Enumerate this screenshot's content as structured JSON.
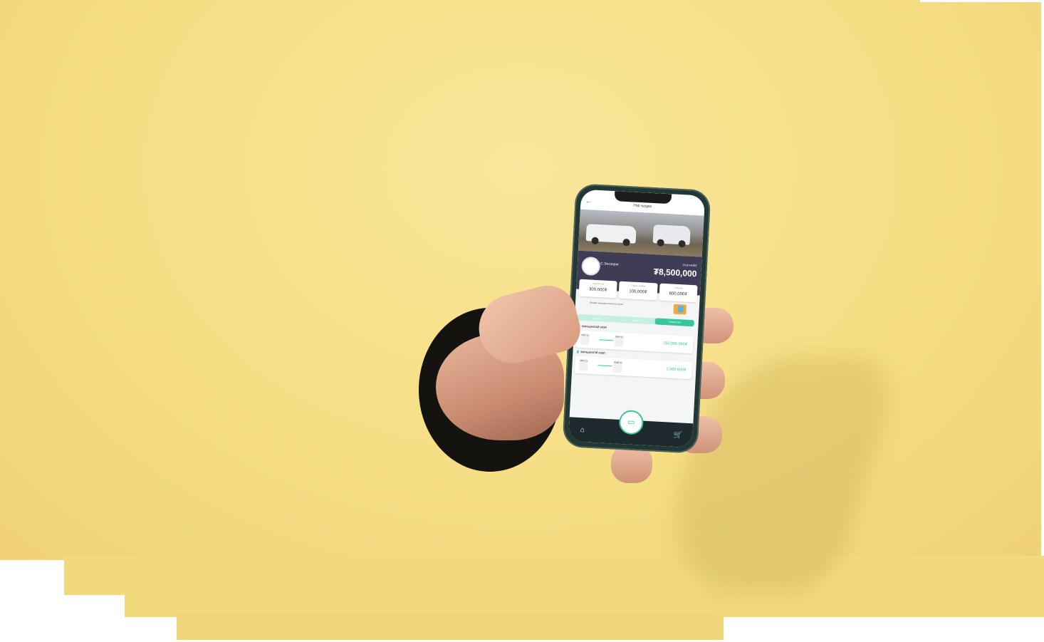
{
  "app": {
    "title": "Нэр хуудас",
    "user_name": "С.Энхзориг",
    "price_label": "ҮНЭ НИЙТ",
    "price_value": "₮8,500,000"
  },
  "cards": [
    {
      "label": "Урьдчилгаа",
      "value": "300,000₮"
    },
    {
      "label": "Сарын төлбөр",
      "value": "100,000₮"
    },
    {
      "label": "Үлдэгдэл",
      "value": "600,000₮"
    }
  ],
  "note": "Онлайн худалдан авалтын хуулга",
  "tabs": [
    "Хуваарь",
    "Төлөлт",
    "Хуваарь дуу"
  ],
  "sections": [
    {
      "title": "БАРЬЦААТАЙ ЗЭЭЛ",
      "from": "MAY 21",
      "to": "MAY 21",
      "amount": "150,000,000₮"
    },
    {
      "title": "БАРЬЦААГҮЙ ЗЭЭЛ",
      "from": "MAY 21",
      "to": "JUNE 21",
      "amount": "1,500,000₮"
    }
  ],
  "icons": [
    "back-arrow-icon",
    "home-icon",
    "wallet-icon",
    "cart-icon"
  ],
  "colors": {
    "background": "#f6df86",
    "accent": "#37c79d",
    "profile_panel": "#3f3d56",
    "phone_frame": "#233832"
  }
}
